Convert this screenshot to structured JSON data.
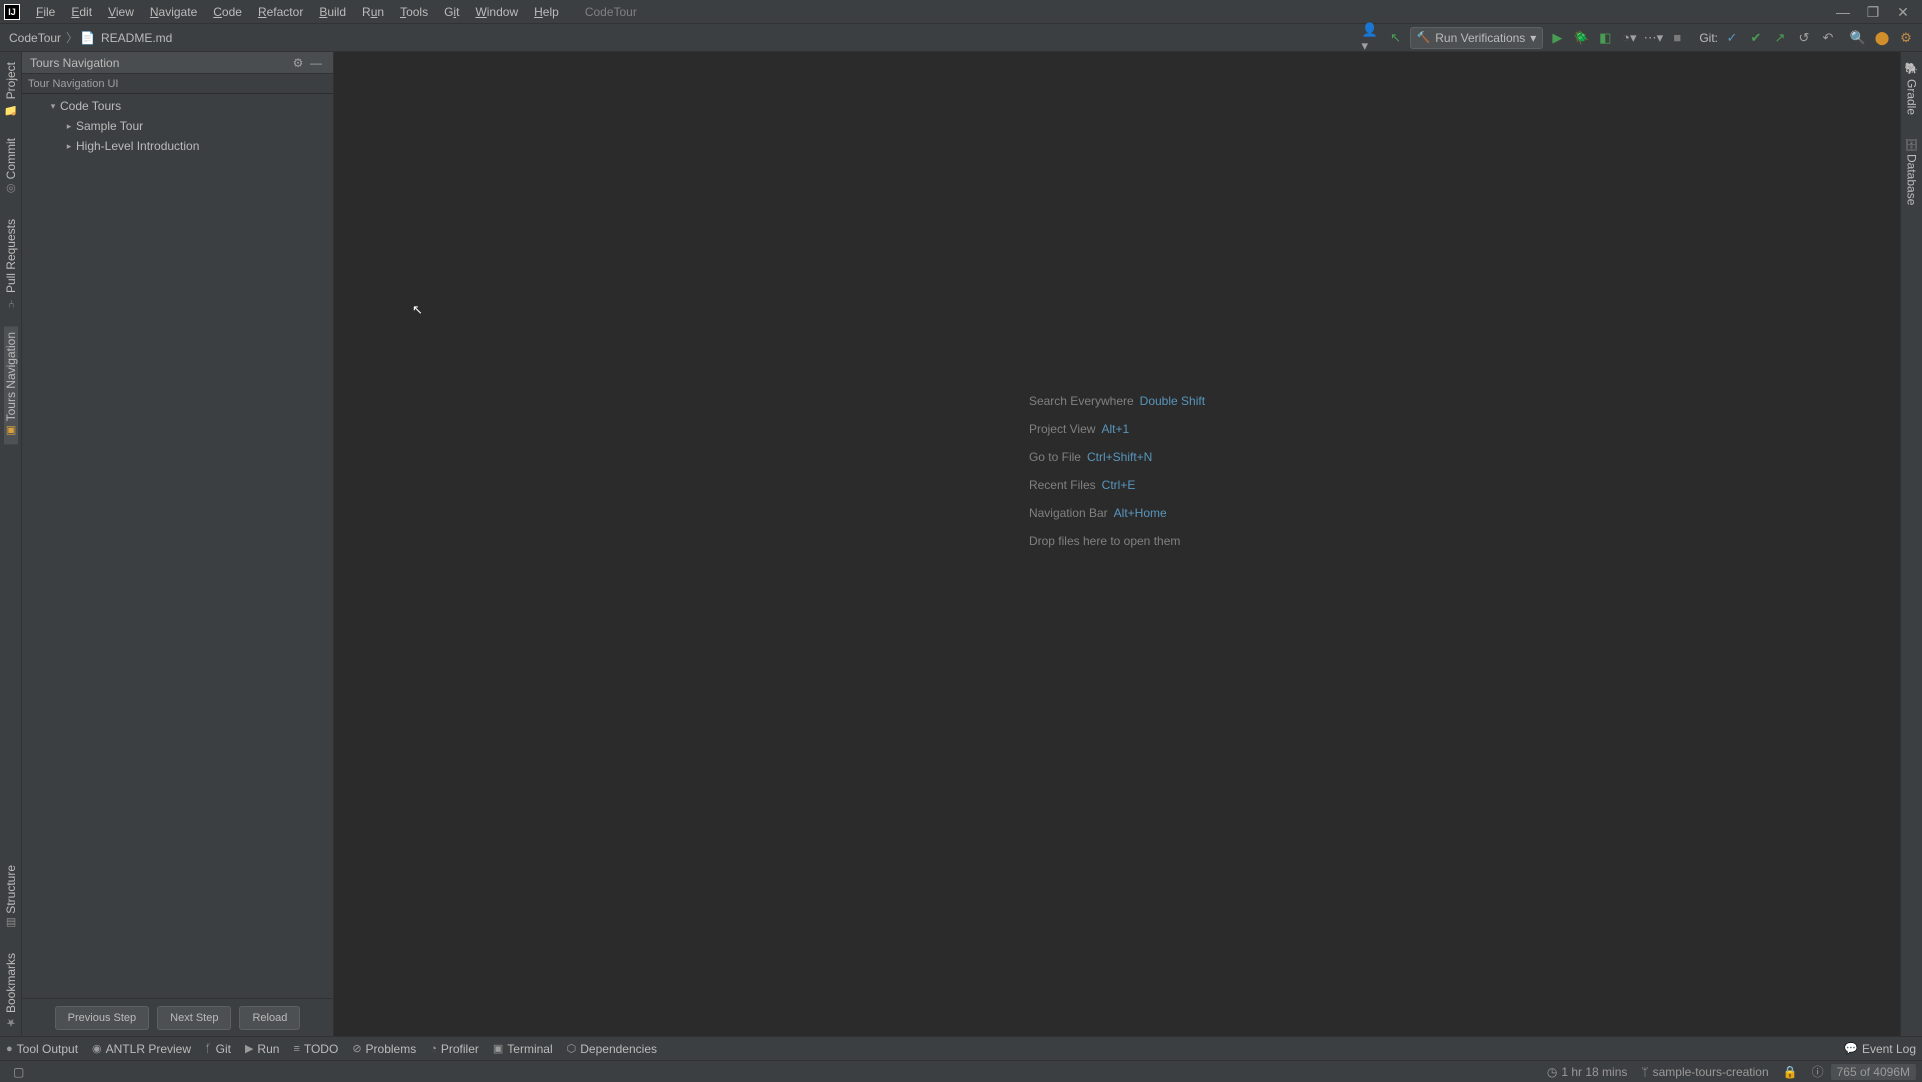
{
  "menubar": {
    "items": [
      "File",
      "Edit",
      "View",
      "Navigate",
      "Code",
      "Refactor",
      "Build",
      "Run",
      "Tools",
      "Git",
      "Window",
      "Help"
    ],
    "project_label": "CodeTour"
  },
  "window_controls": {
    "minimize": "—",
    "maximize": "❐",
    "close": "✕"
  },
  "breadcrumb": {
    "root": "CodeTour",
    "file": "README.md"
  },
  "run_config": {
    "label": "Run Verifications"
  },
  "git_label": "Git:",
  "tool_window": {
    "title": "Tours Navigation",
    "subtitle": "Tour Navigation UI",
    "tree": {
      "root": "Code Tours",
      "children": [
        "Sample Tour",
        "High-Level Introduction"
      ]
    },
    "buttons": {
      "prev": "Previous Step",
      "next": "Next Step",
      "reload": "Reload"
    }
  },
  "left_tabs": [
    "Project",
    "Commit",
    "Pull Requests",
    "Tours Navigation",
    "Structure",
    "Bookmarks"
  ],
  "right_tabs": [
    "Gradle",
    "Database"
  ],
  "editor_hints": [
    {
      "label": "Search Everywhere",
      "shortcut": "Double Shift"
    },
    {
      "label": "Project View",
      "shortcut": "Alt+1"
    },
    {
      "label": "Go to File",
      "shortcut": "Ctrl+Shift+N"
    },
    {
      "label": "Recent Files",
      "shortcut": "Ctrl+E"
    },
    {
      "label": "Navigation Bar",
      "shortcut": "Alt+Home"
    },
    {
      "label": "Drop files here to open them",
      "shortcut": ""
    }
  ],
  "bottom_tabs": [
    {
      "icon": "●",
      "label": "Tool Output"
    },
    {
      "icon": "◉",
      "label": "ANTLR Preview"
    },
    {
      "icon": "ᚶ",
      "label": "Git"
    },
    {
      "icon": "▶",
      "label": "Run"
    },
    {
      "icon": "≡",
      "label": "TODO"
    },
    {
      "icon": "⊘",
      "label": "Problems"
    },
    {
      "icon": "◔",
      "label": "Profiler"
    },
    {
      "icon": "▣",
      "label": "Terminal"
    },
    {
      "icon": "⬡",
      "label": "Dependencies"
    }
  ],
  "event_log": "Event Log",
  "status": {
    "time": "1 hr 18 mins",
    "branch": "sample-tours-creation",
    "memory": "765 of 4096M"
  }
}
